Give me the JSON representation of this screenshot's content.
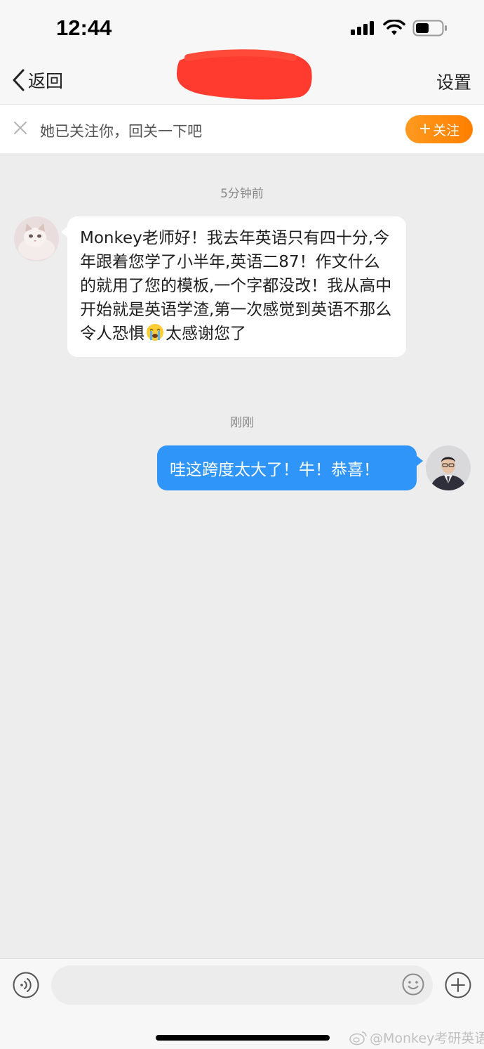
{
  "status_bar": {
    "time": "12:44"
  },
  "nav": {
    "back_label": "返回",
    "settings_label": "设置"
  },
  "follow_banner": {
    "text": "她已关注你，回关一下吧",
    "button_label": "关注"
  },
  "messages": [
    {
      "timestamp": "5分钟前",
      "direction": "incoming",
      "text_before_emoji": "Monkey老师好！我去年英语只有四十分,今年跟着您学了小半年,英语二87！作文什么的就用了您的模板,一个字都没改！我从高中开始就是英语学渣,第一次感觉到英语不那么令人恐惧",
      "emoji": "loudly-crying-face",
      "text_after_emoji": "太感谢您了"
    },
    {
      "timestamp": "刚刚",
      "direction": "outgoing",
      "text": "哇这跨度太大了！牛！恭喜！"
    }
  ],
  "input_bar": {
    "placeholder": "",
    "watermark": "@Monkey考研英语"
  },
  "colors": {
    "outgoing_bubble": "#2f95f8",
    "follow_button": "#ff8c0a",
    "background": "#ededed"
  }
}
